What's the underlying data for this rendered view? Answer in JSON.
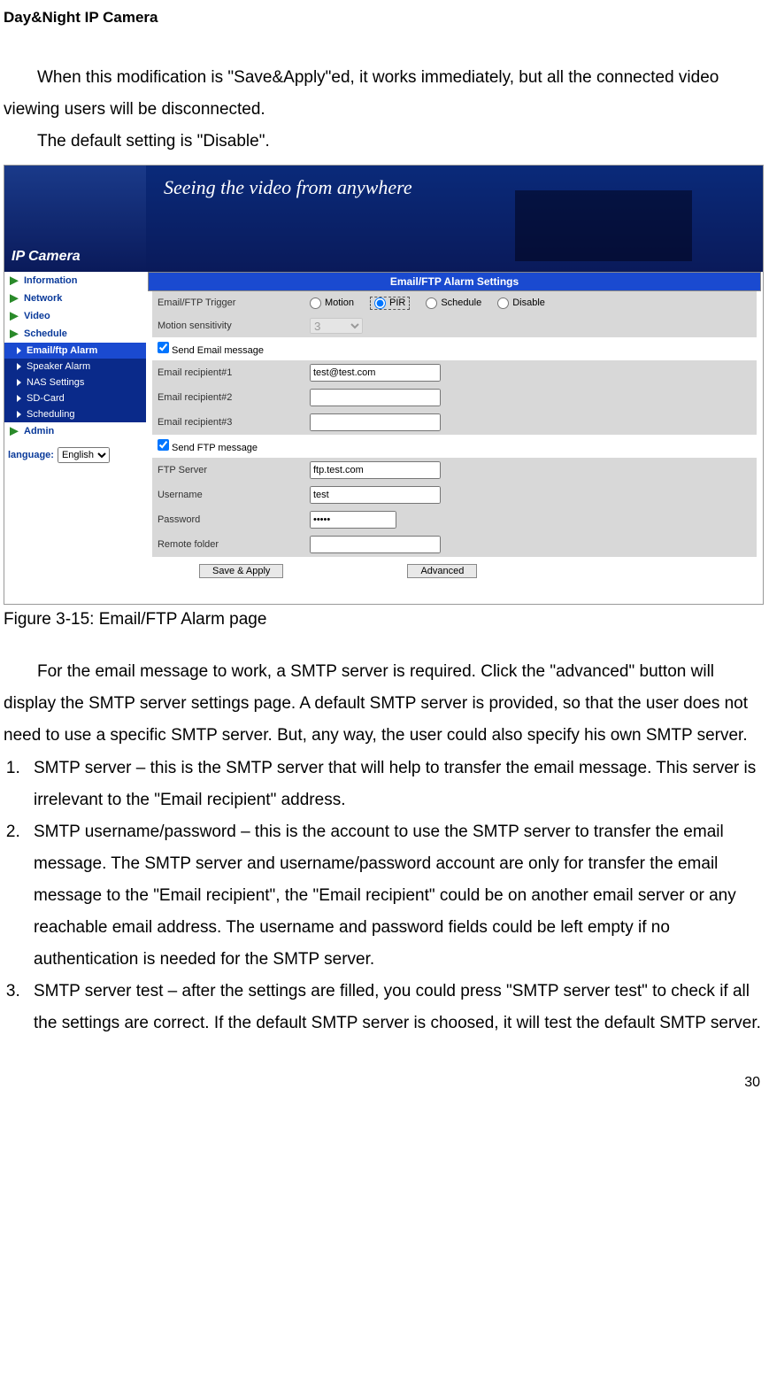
{
  "doc_header": "Day&Night IP Camera",
  "intro": {
    "p1": "When this modification is \"Save&Apply\"ed, it works immediately, but all the connected video viewing users will be disconnected.",
    "p2": "The default setting is \"Disable\"."
  },
  "screenshot": {
    "logo": "IP Camera",
    "banner_text": "Seeing the video from anywhere",
    "sidebar": {
      "items": [
        "Information",
        "Network",
        "Video",
        "Schedule"
      ],
      "sub_items": [
        "Email/ftp Alarm",
        "Speaker Alarm",
        "NAS Settings",
        "SD-Card",
        "Scheduling"
      ],
      "admin": "Admin",
      "lang_label": "language:",
      "lang_value": "English"
    },
    "content_title": "Email/FTP Alarm Settings",
    "form": {
      "trigger_label": "Email/FTP Trigger",
      "trigger_options": {
        "motion": "Motion",
        "pir": "PIR",
        "schedule": "Schedule",
        "disable": "Disable"
      },
      "sensitivity_label": "Motion sensitivity",
      "sensitivity_value": "3",
      "send_email_label": "Send Email message",
      "recipient1_label": "Email recipient#1",
      "recipient1_value": "test@test.com",
      "recipient2_label": "Email recipient#2",
      "recipient2_value": "",
      "recipient3_label": "Email recipient#3",
      "recipient3_value": "",
      "send_ftp_label": "Send FTP message",
      "ftp_server_label": "FTP Server",
      "ftp_server_value": "ftp.test.com",
      "username_label": "Username",
      "username_value": "test",
      "password_label": "Password",
      "password_value": "•••••",
      "remote_folder_label": "Remote folder",
      "remote_folder_value": "",
      "save_btn": "Save & Apply",
      "advanced_btn": "Advanced"
    }
  },
  "caption": "Figure 3-15: Email/FTP Alarm page",
  "para_advanced": "For the email message to work, a SMTP server is required. Click the \"advanced\" button will display the SMTP server settings page. A default SMTP server is provided, so that the user does not need to use a specific SMTP server. But, any way, the user could also specify his own SMTP server.",
  "list": {
    "i1": "SMTP server – this is the SMTP server that will help to transfer the email message. This server is irrelevant to the \"Email recipient\" address.",
    "i2": "SMTP username/password – this is the account to use the SMTP server to transfer the email message. The SMTP server and username/password account are only for transfer the email message to the \"Email recipient\", the \"Email recipient\" could be on another email server or any reachable email address. The username and password fields could be left empty if no authentication is needed for the SMTP server.",
    "i3": "SMTP server test – after the settings are filled, you could press \"SMTP server test\" to check if all the settings are correct. If the default SMTP server is choosed, it will test the default SMTP server."
  },
  "page_number": "30"
}
